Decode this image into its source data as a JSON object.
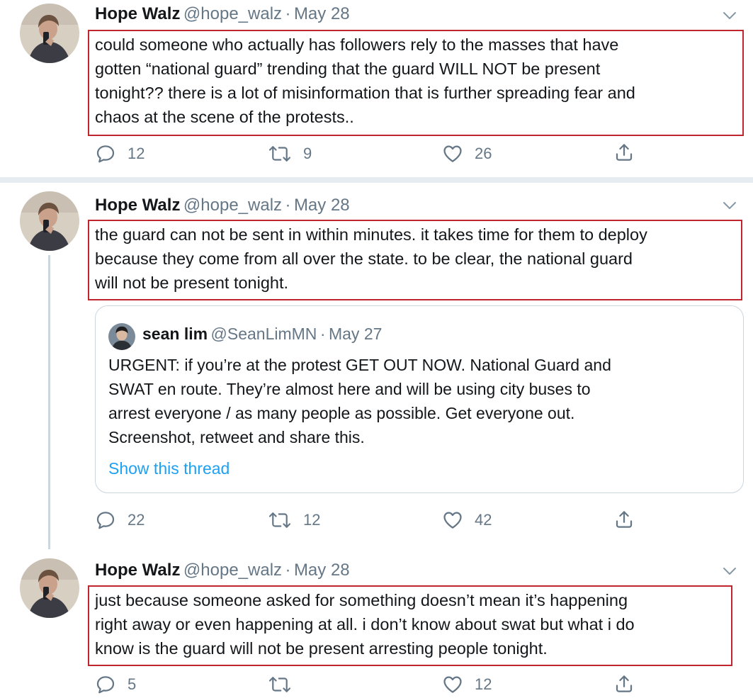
{
  "tweets": [
    {
      "name": "Hope Walz",
      "handle": "@hope_walz",
      "date": "May 28",
      "lines": [
        "could someone who actually has followers rely to the masses that have",
        "gotten “national guard” trending that the guard WILL NOT be present",
        "tonight?? there is a lot of misinformation that is further spreading fear and",
        "chaos at the scene of the protests.."
      ],
      "replies": "12",
      "retweets": "9",
      "likes": "26"
    },
    {
      "name": "Hope Walz",
      "handle": "@hope_walz",
      "date": "May 28",
      "lines": [
        "the guard can not be sent in within minutes. it takes time for them to deploy",
        "because they come from all over the state. to be clear, the national guard",
        "will not be present tonight."
      ],
      "replies": "22",
      "retweets": "12",
      "likes": "42",
      "quote": {
        "name": "sean lim",
        "handle": "@SeanLimMN",
        "date": "May 27",
        "lines": [
          "URGENT: if you’re at the protest GET OUT NOW. National Guard and",
          "SWAT en route. They’re almost here and will be using city buses to",
          "arrest everyone / as many people as possible. Get everyone out.",
          "Screenshot, retweet and share this."
        ],
        "show_thread": "Show this thread"
      }
    },
    {
      "name": "Hope Walz",
      "handle": "@hope_walz",
      "date": "May 28",
      "lines": [
        "just because someone asked for something doesn’t mean it’s happening",
        "right away or even happening at all. i don’t know about swat but what i do",
        "know is the guard will not be present arresting people tonight."
      ],
      "replies": "5",
      "retweets": "",
      "likes": "12"
    }
  ],
  "separator": "·",
  "icons": [
    "reply-icon",
    "retweet-icon",
    "like-icon",
    "share-icon",
    "chevron-down-icon"
  ],
  "colors": {
    "highlight_border": "#c0262d",
    "link": "#1da1f2",
    "secondary_text": "#657786",
    "divider": "#e6ecf0"
  }
}
